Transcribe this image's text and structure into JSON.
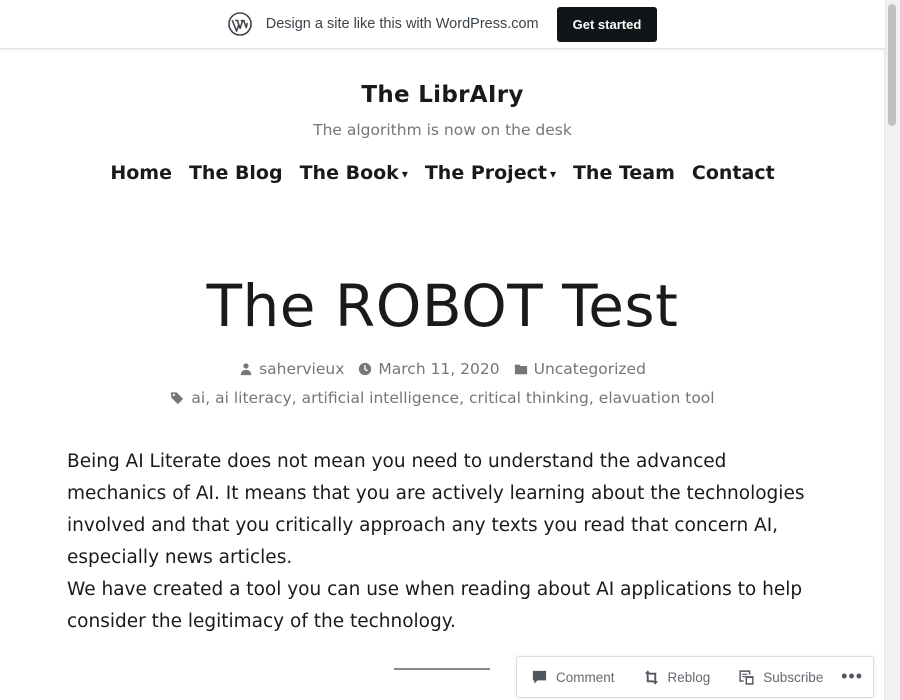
{
  "wp_banner": {
    "text": "Design a site like this with WordPress.com",
    "button": "Get started",
    "logo_icon": "wordpress-logo-icon"
  },
  "site": {
    "title": "The LibrAIry",
    "tagline": "The algorithm is now on the desk"
  },
  "nav": {
    "items": [
      {
        "label": "Home",
        "has_dropdown": false
      },
      {
        "label": "The Blog",
        "has_dropdown": false
      },
      {
        "label": "The Book",
        "has_dropdown": true
      },
      {
        "label": "The Project",
        "has_dropdown": true
      },
      {
        "label": "The Team",
        "has_dropdown": false
      },
      {
        "label": "Contact",
        "has_dropdown": false
      }
    ],
    "dropdown_glyph": "▾"
  },
  "post": {
    "title": "The ROBOT Test",
    "author": "sahervieux",
    "date": "March 11, 2020",
    "category": "Uncategorized",
    "tags": [
      "ai",
      "ai literacy",
      "artificial intelligence",
      "critical thinking",
      "elavuation tool"
    ],
    "paragraphs": [
      "Being AI Literate does not mean you need to understand the advanced mechanics of AI. It means that you are actively learning about the technologies involved and that you critically approach any texts you read that concern AI, especially news articles.",
      "We have created a tool you can use when reading about AI applications to help consider the legitimacy of the technology."
    ]
  },
  "actionbar": {
    "comment": "Comment",
    "reblog": "Reblog",
    "subscribe": "Subscribe",
    "more": "•••"
  },
  "colors": {
    "text": "#1a1a1a",
    "muted": "#767676",
    "button_bg": "#101517"
  }
}
